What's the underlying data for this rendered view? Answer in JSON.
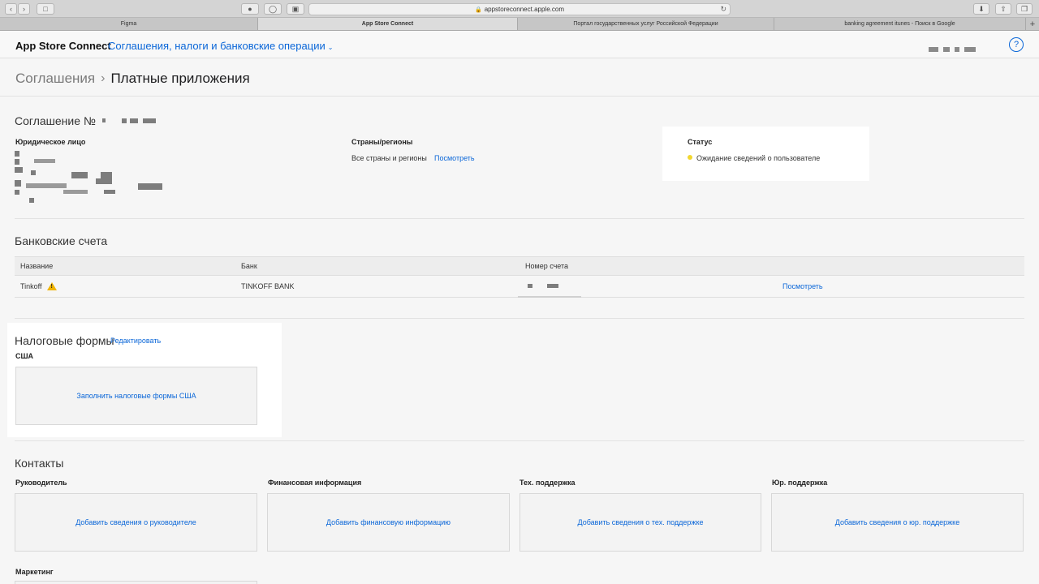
{
  "browser": {
    "url": "appstoreconnect.apple.com",
    "tabs": [
      "Figma",
      "App Store Connect",
      "Портал государственных услуг Российской Федерации",
      "banking agreement itunes - Поиск в Google"
    ],
    "active_tab": 1
  },
  "header": {
    "brand": "App Store Connect",
    "section": "Соглашения, налоги и банковские операции",
    "help": "?"
  },
  "breadcrumb": {
    "parent": "Соглашения",
    "current": "Платные приложения"
  },
  "agreement": {
    "title": "Соглашение №",
    "legal_entity_label": "Юридическое лицо",
    "countries_label": "Страны/регионы",
    "countries_value": "Все страны и регионы",
    "countries_link": "Посмотреть",
    "status_label": "Статус",
    "status_value": "Ожидание сведений о пользователе",
    "status_color": "#f2d72f"
  },
  "bank": {
    "title": "Банковские счета",
    "columns": [
      "Название",
      "Банк",
      "Номер счета"
    ],
    "rows": [
      {
        "name": "Tinkoff",
        "bank": "TINKOFF BANK",
        "link": "Посмотреть",
        "warning_icon": "warning-icon"
      }
    ]
  },
  "tax": {
    "title": "Налоговые формы",
    "edit_link": "Редактировать",
    "region": "США",
    "fill_button": "Заполнить налоговые формы США"
  },
  "contacts": {
    "title": "Контакты",
    "items": [
      {
        "label": "Руководитель",
        "button": "Добавить сведения о руководителе"
      },
      {
        "label": "Финансовая информация",
        "button": "Добавить финансовую информацию"
      },
      {
        "label": "Тех. поддержка",
        "button": "Добавить сведения о тех. поддержке"
      },
      {
        "label": "Юр. поддержка",
        "button": "Добавить сведения о юр. поддержке"
      }
    ],
    "marketing_label": "Маркетинг"
  },
  "colors": {
    "link": "#0a66d8",
    "warning": "#f0b400"
  }
}
